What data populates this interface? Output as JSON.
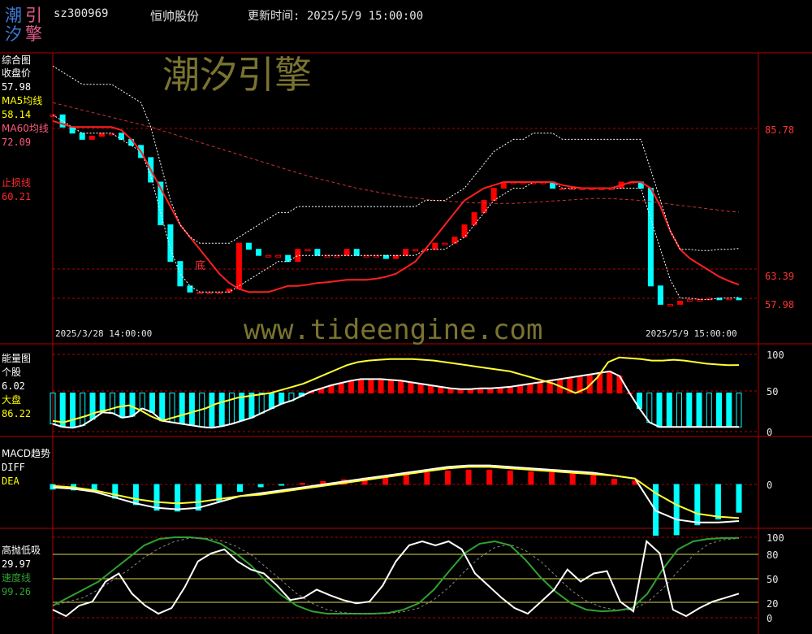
{
  "logo": {
    "c1": "潮",
    "c2": "引",
    "c3": "汐",
    "c4": "擎"
  },
  "header": {
    "code": "sz300969",
    "name": "恒帅股份",
    "update_label": "更新时间: 2025/5/9 15:00:00"
  },
  "watermark": {
    "brand": "潮汐引擎",
    "url": "www.tideengine.com"
  },
  "colors": {
    "bg": "#000000",
    "grid": "#b40000",
    "up": "#ff0000",
    "down": "#00ffff",
    "ma5": "#ffff00",
    "ma60": "#ff3c3c",
    "stop": "#ff2020",
    "white": "#ffffff",
    "yellow": "#ffff33",
    "green": "#2fa12f"
  },
  "panels": {
    "main": {
      "title": "综合图",
      "close_label": "收盘价",
      "close_value": "57.98",
      "ma5_label": "MA5均线",
      "ma5_value": "58.14",
      "ma60_label": "MA60均线",
      "ma60_value": "72.09",
      "stop_label": "止损线",
      "stop_value": "60.21",
      "bottom_marker": "底",
      "date_start": "2025/3/28 14:00:00",
      "date_end": "2025/5/9 15:00:00",
      "right_labels": [
        "85.78",
        "63.39",
        "57.98"
      ]
    },
    "energy": {
      "title": "能量图",
      "stock_label": "个股",
      "stock_value": "6.02",
      "market_label": "大盘",
      "market_value": "86.22",
      "right_labels": [
        "100",
        "50",
        "0"
      ]
    },
    "macd": {
      "title": "MACD趋势",
      "diff_label": "DIFF",
      "dea_label": "DEA",
      "right_labels": [
        "0"
      ]
    },
    "oscillator": {
      "title": "高抛低吸",
      "value": "29.97",
      "speed_label": "速度线",
      "speed_value": "99.26",
      "right_labels": [
        "100",
        "80",
        "50",
        "20",
        "0"
      ]
    }
  },
  "chart_data": [
    {
      "type": "line",
      "title": "综合图",
      "x": [
        "2025/3/28 14:00:00",
        "2025/5/9 15:00:00"
      ],
      "ylim": [
        55,
        100
      ],
      "right_axis_ticks": [
        85.78,
        63.39,
        57.98
      ],
      "series": [
        {
          "name": "收盘价",
          "values": [
            88,
            86,
            85,
            84,
            84.5,
            85,
            85,
            84,
            83,
            81,
            77,
            70,
            64,
            60,
            59,
            59,
            59,
            59,
            59.5,
            67,
            66,
            65,
            65,
            65,
            64,
            66,
            66,
            65,
            65,
            65,
            66,
            65,
            65,
            65,
            64.5,
            65,
            66,
            66,
            66,
            67,
            67,
            68,
            70,
            72,
            74,
            76,
            77,
            77,
            77,
            77,
            77,
            76,
            76,
            76,
            76,
            76,
            76,
            76,
            77,
            77,
            76,
            60,
            57,
            57,
            57.5,
            57.8,
            57.8,
            58,
            57.9,
            58,
            57.98
          ]
        },
        {
          "name": "MA5均线",
          "values": [
            88,
            87,
            86,
            85,
            85,
            85,
            85,
            84,
            83,
            82,
            78,
            72,
            66,
            62,
            60,
            59,
            59,
            59,
            59,
            60,
            61,
            62,
            63,
            64,
            64,
            65,
            65,
            65,
            65,
            65,
            65,
            65,
            65,
            65,
            65,
            65,
            65,
            65,
            66,
            66,
            66,
            67,
            68,
            70,
            72,
            74,
            75,
            76,
            76,
            77,
            77,
            77,
            76,
            76,
            76,
            76,
            76,
            76,
            76,
            76,
            76,
            71,
            66,
            61,
            58,
            58,
            57.8,
            57.8,
            58,
            58,
            58.14
          ]
        },
        {
          "name": "MA60均线",
          "values": [
            90,
            89.6,
            89.2,
            88.8,
            88.4,
            88,
            87.6,
            87.2,
            86.8,
            86.4,
            86,
            85.5,
            85,
            84.5,
            84,
            83.5,
            83,
            82.5,
            82,
            81.5,
            81,
            80.5,
            80,
            79.5,
            79,
            78.5,
            78,
            77.6,
            77.2,
            76.8,
            76.4,
            76,
            75.7,
            75.4,
            75.1,
            74.8,
            74.6,
            74.4,
            74.2,
            74,
            73.9,
            73.8,
            73.7,
            73.6,
            73.6,
            73.5,
            73.5,
            73.5,
            73.6,
            73.7,
            73.8,
            73.9,
            74,
            74.1,
            74.2,
            74.3,
            74.3,
            74.3,
            74.2,
            74.1,
            74,
            73.8,
            73.6,
            73.4,
            73.2,
            73,
            72.8,
            72.6,
            72.4,
            72.2,
            72.09
          ]
        },
        {
          "name": "止损线",
          "values": [
            87,
            86.5,
            86,
            86,
            86,
            86,
            86,
            85.5,
            84,
            82,
            79,
            76,
            73,
            70,
            68,
            66,
            64,
            62,
            60.5,
            59.5,
            59,
            59,
            59,
            59.5,
            60,
            60,
            60.2,
            60.5,
            60.6,
            60.8,
            61,
            61,
            61,
            61.2,
            61.5,
            62,
            63,
            64,
            66,
            68,
            70,
            72,
            74,
            75,
            76,
            76.5,
            77,
            77,
            77,
            77,
            77,
            77,
            76.5,
            76.2,
            76,
            76,
            76,
            76,
            76.5,
            77,
            77,
            76,
            73,
            69,
            66,
            64.5,
            63.5,
            62.5,
            61.5,
            60.8,
            60.21
          ]
        }
      ]
    },
    {
      "type": "bar",
      "title": "能量图",
      "ylim": [
        0,
        100
      ],
      "series": [
        {
          "name": "个股",
          "values": [
            10,
            6,
            5,
            8,
            16,
            25,
            24,
            18,
            20,
            30,
            25,
            14,
            12,
            10,
            8,
            6,
            5,
            7,
            10,
            14,
            18,
            24,
            30,
            36,
            40,
            46,
            52,
            56,
            60,
            63,
            66,
            68,
            68,
            68,
            67,
            66,
            64,
            62,
            60,
            58,
            56,
            55,
            55,
            56,
            56,
            57,
            58,
            60,
            62,
            64,
            66,
            68,
            70,
            72,
            74,
            76,
            78,
            72,
            50,
            30,
            12,
            6,
            6,
            6,
            6,
            6,
            6,
            6,
            6,
            6.02
          ]
        },
        {
          "name": "大盘",
          "values": [
            14,
            12,
            16,
            20,
            25,
            28,
            32,
            34,
            28,
            20,
            14,
            18,
            22,
            26,
            30,
            36,
            40,
            44,
            46,
            48,
            50,
            54,
            58,
            62,
            68,
            74,
            80,
            86,
            90,
            92,
            93,
            94,
            94,
            94,
            93,
            92,
            90,
            88,
            86,
            84,
            82,
            80,
            78,
            74,
            70,
            66,
            62,
            56,
            50,
            56,
            70,
            90,
            96,
            95,
            94,
            92,
            92,
            93,
            92,
            90,
            88,
            87,
            86,
            86.22
          ]
        }
      ]
    },
    {
      "type": "bar",
      "title": "MACD趋势",
      "series": [
        {
          "name": "DIFF",
          "values": [
            -0.2,
            -0.3,
            -0.5,
            -0.9,
            -1.3,
            -1.6,
            -1.7,
            -1.6,
            -1.2,
            -0.8,
            -0.6,
            -0.4,
            -0.2,
            0,
            0.2,
            0.4,
            0.6,
            0.8,
            1,
            1.2,
            1.3,
            1.3,
            1.2,
            1.1,
            1,
            0.9,
            0.8,
            0.6,
            0.4,
            -1.8,
            -2.4,
            -2.6,
            -2.6,
            -2.5
          ]
        },
        {
          "name": "DEA",
          "values": [
            -0.1,
            -0.2,
            -0.4,
            -0.7,
            -1,
            -1.2,
            -1.3,
            -1.2,
            -1,
            -0.8,
            -0.7,
            -0.5,
            -0.3,
            -0.1,
            0.1,
            0.3,
            0.5,
            0.7,
            0.9,
            1.1,
            1.2,
            1.2,
            1.1,
            1,
            0.9,
            0.8,
            0.7,
            0.6,
            0.4,
            -0.6,
            -1.4,
            -2,
            -2.2,
            -2.3
          ]
        }
      ]
    },
    {
      "type": "line",
      "title": "高抛低吸",
      "ylim": [
        0,
        100
      ],
      "series": [
        {
          "name": "高抛低吸",
          "values": [
            10,
            2,
            15,
            20,
            45,
            55,
            30,
            15,
            5,
            12,
            38,
            70,
            80,
            85,
            70,
            60,
            55,
            40,
            22,
            25,
            35,
            28,
            22,
            18,
            20,
            40,
            70,
            90,
            95,
            90,
            95,
            85,
            55,
            40,
            25,
            12,
            5,
            20,
            35,
            60,
            45,
            55,
            58,
            20,
            8,
            95,
            80,
            10,
            2,
            12,
            20,
            25,
            29.97
          ]
        },
        {
          "name": "速度线",
          "values": [
            15,
            25,
            35,
            45,
            60,
            75,
            90,
            98,
            100,
            100,
            98,
            92,
            80,
            65,
            45,
            28,
            15,
            8,
            5,
            5,
            5,
            5,
            6,
            10,
            18,
            35,
            58,
            80,
            92,
            95,
            90,
            72,
            50,
            32,
            18,
            10,
            8,
            9,
            12,
            30,
            60,
            85,
            95,
            98,
            99,
            99.26
          ]
        }
      ]
    }
  ]
}
